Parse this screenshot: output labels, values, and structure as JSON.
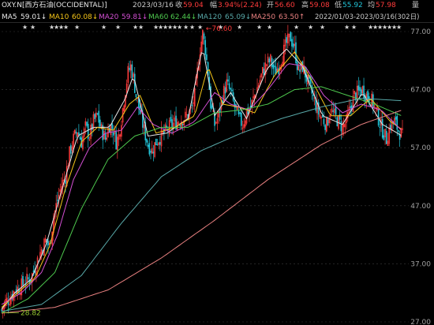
{
  "header": {
    "symbol": "OXY.N[西方石油(OCCIDENTAL)]",
    "date": "2023/03/16",
    "close_label": "收",
    "close_value": "59.04",
    "change_label": "幅",
    "change_value": "3.94%(2.24)",
    "open_label": "开",
    "open_value": "56.60",
    "high_label": "高",
    "high_value": "59.08",
    "low_label": "低",
    "low_value": "55.92",
    "avg_label": "均",
    "avg_value": "57.98",
    "volume_label": "量"
  },
  "ma_row": {
    "ma5_label": "MA5",
    "ma5_value": "59.01↓",
    "ma10_label": "MA10",
    "ma10_value": "60.08↓",
    "ma20_label": "MA20",
    "ma20_value": "59.81↓",
    "ma60_label": "MA60",
    "ma60_value": "62.44↓",
    "ma120_label": "MA120",
    "ma120_value": "65.09↓",
    "ma250_label": "MA250",
    "ma250_value": "63.50↑",
    "range_label": "2022/01/03-2023/03/16(302日)"
  },
  "colors": {
    "background": "#000000",
    "up": "#ff3b3b",
    "down": "#22c4d8",
    "ma5": "#e8e8e8",
    "ma10": "#f5c518",
    "ma20": "#d34fd3",
    "ma60": "#4ec94e",
    "ma120": "#58a8a8",
    "ma250": "#e88080",
    "grid": "#3a3a3a",
    "header_date": "#c8c8c8"
  },
  "chart_data": {
    "type": "candlestick",
    "x_start": "2022/01/03",
    "x_end": "2023/03/16",
    "n_bars": 302,
    "y_ticks": [
      27.0,
      37.0,
      47.0,
      57.0,
      67.0,
      77.0
    ],
    "ylim": [
      27,
      77
    ],
    "annotations": [
      {
        "text": "←76.60",
        "value": 76.6,
        "kind": "max"
      },
      {
        "text": "28.82",
        "value": 28.82,
        "kind": "min"
      }
    ],
    "series": [
      {
        "name": "price",
        "points": [
          [
            0,
            29.0
          ],
          [
            3,
            30.5
          ],
          [
            6,
            31.0
          ],
          [
            10,
            32.5
          ],
          [
            14,
            33.0
          ],
          [
            18,
            34.0
          ],
          [
            22,
            34.5
          ],
          [
            26,
            37.0
          ],
          [
            30,
            39.5
          ],
          [
            33,
            41.0
          ],
          [
            36,
            40.0
          ],
          [
            39,
            45.0
          ],
          [
            42,
            48.0
          ],
          [
            45,
            50.5
          ],
          [
            48,
            52.0
          ],
          [
            51,
            56.0
          ],
          [
            54,
            58.5
          ],
          [
            57,
            60.0
          ],
          [
            60,
            58.0
          ],
          [
            63,
            60.5
          ],
          [
            66,
            59.0
          ],
          [
            69,
            61.5
          ],
          [
            72,
            62.5
          ],
          [
            75,
            60.0
          ],
          [
            78,
            58.5
          ],
          [
            81,
            61.0
          ],
          [
            84,
            60.0
          ],
          [
            86,
            58.0
          ],
          [
            88,
            59.0
          ],
          [
            90,
            62.0
          ],
          [
            93,
            67.0
          ],
          [
            95,
            70.0
          ],
          [
            97,
            71.0
          ],
          [
            99,
            69.0
          ],
          [
            101,
            66.0
          ],
          [
            104,
            63.0
          ],
          [
            107,
            60.0
          ],
          [
            110,
            57.5
          ],
          [
            113,
            56.5
          ],
          [
            116,
            58.0
          ],
          [
            120,
            59.0
          ],
          [
            124,
            60.0
          ],
          [
            128,
            61.0
          ],
          [
            132,
            61.5
          ],
          [
            136,
            62.0
          ],
          [
            140,
            62.5
          ],
          [
            143,
            64.0
          ],
          [
            145,
            66.0
          ],
          [
            147,
            70.0
          ],
          [
            149,
            74.0
          ],
          [
            151,
            76.6
          ],
          [
            153,
            74.0
          ],
          [
            155,
            70.0
          ],
          [
            157,
            64.5
          ],
          [
            160,
            61.0
          ],
          [
            163,
            62.5
          ],
          [
            166,
            66.0
          ],
          [
            169,
            68.0
          ],
          [
            172,
            66.5
          ],
          [
            175,
            64.0
          ],
          [
            178,
            62.0
          ],
          [
            181,
            61.0
          ],
          [
            184,
            63.0
          ],
          [
            187,
            64.0
          ],
          [
            190,
            66.0
          ],
          [
            193,
            68.0
          ],
          [
            196,
            70.0
          ],
          [
            199,
            71.5
          ],
          [
            202,
            72.0
          ],
          [
            205,
            70.0
          ],
          [
            208,
            71.0
          ],
          [
            211,
            73.0
          ],
          [
            214,
            75.0
          ],
          [
            217,
            76.0
          ],
          [
            220,
            74.0
          ],
          [
            223,
            70.0
          ],
          [
            226,
            71.0
          ],
          [
            229,
            69.0
          ],
          [
            232,
            67.0
          ],
          [
            235,
            65.0
          ],
          [
            238,
            63.0
          ],
          [
            241,
            62.0
          ],
          [
            244,
            61.0
          ],
          [
            247,
            63.5
          ],
          [
            250,
            62.5
          ],
          [
            253,
            61.5
          ],
          [
            256,
            60.5
          ],
          [
            259,
            61.5
          ],
          [
            262,
            64.0
          ],
          [
            265,
            66.0
          ],
          [
            268,
            66.5
          ],
          [
            271,
            67.0
          ],
          [
            274,
            66.0
          ],
          [
            277,
            65.5
          ],
          [
            280,
            64.0
          ],
          [
            283,
            62.0
          ],
          [
            286,
            60.0
          ],
          [
            289,
            58.5
          ],
          [
            292,
            61.0
          ],
          [
            295,
            61.5
          ],
          [
            298,
            60.0
          ],
          [
            301,
            59.04
          ]
        ]
      },
      {
        "name": "MA5",
        "points": [
          [
            0,
            29.2
          ],
          [
            10,
            32.0
          ],
          [
            22,
            34.3
          ],
          [
            33,
            40.0
          ],
          [
            45,
            49.5
          ],
          [
            57,
            59.0
          ],
          [
            69,
            60.5
          ],
          [
            81,
            60.5
          ],
          [
            93,
            65.5
          ],
          [
            99,
            69.5
          ],
          [
            110,
            59.0
          ],
          [
            124,
            59.5
          ],
          [
            140,
            62.0
          ],
          [
            151,
            74.5
          ],
          [
            160,
            62.5
          ],
          [
            172,
            66.5
          ],
          [
            184,
            62.0
          ],
          [
            199,
            70.5
          ],
          [
            214,
            74.0
          ],
          [
            226,
            71.0
          ],
          [
            241,
            62.5
          ],
          [
            256,
            61.0
          ],
          [
            271,
            66.5
          ],
          [
            286,
            61.0
          ],
          [
            301,
            59.0
          ]
        ]
      },
      {
        "name": "MA10",
        "points": [
          [
            0,
            29.5
          ],
          [
            12,
            32.0
          ],
          [
            25,
            34.5
          ],
          [
            36,
            40.0
          ],
          [
            48,
            50.0
          ],
          [
            60,
            58.0
          ],
          [
            72,
            60.5
          ],
          [
            84,
            60.0
          ],
          [
            96,
            64.5
          ],
          [
            104,
            66.0
          ],
          [
            116,
            59.5
          ],
          [
            130,
            60.5
          ],
          [
            145,
            62.5
          ],
          [
            155,
            71.0
          ],
          [
            166,
            64.5
          ],
          [
            178,
            64.0
          ],
          [
            190,
            63.0
          ],
          [
            205,
            69.5
          ],
          [
            220,
            73.5
          ],
          [
            232,
            69.0
          ],
          [
            247,
            62.5
          ],
          [
            262,
            62.5
          ],
          [
            277,
            65.5
          ],
          [
            292,
            61.5
          ],
          [
            301,
            60.08
          ]
        ]
      },
      {
        "name": "MA20",
        "points": [
          [
            0,
            30.0
          ],
          [
            15,
            32.0
          ],
          [
            30,
            35.5
          ],
          [
            42,
            42.0
          ],
          [
            54,
            51.5
          ],
          [
            66,
            57.0
          ],
          [
            78,
            59.5
          ],
          [
            90,
            60.0
          ],
          [
            102,
            64.0
          ],
          [
            114,
            61.0
          ],
          [
            128,
            59.5
          ],
          [
            145,
            61.5
          ],
          [
            160,
            66.5
          ],
          [
            172,
            64.5
          ],
          [
            186,
            63.5
          ],
          [
            200,
            67.0
          ],
          [
            215,
            71.5
          ],
          [
            228,
            71.0
          ],
          [
            242,
            66.0
          ],
          [
            256,
            63.0
          ],
          [
            270,
            64.5
          ],
          [
            285,
            63.5
          ],
          [
            301,
            59.81
          ]
        ]
      },
      {
        "name": "MA60",
        "points": [
          [
            0,
            28.5
          ],
          [
            20,
            31.0
          ],
          [
            40,
            35.5
          ],
          [
            60,
            46.5
          ],
          [
            80,
            55.0
          ],
          [
            100,
            59.0
          ],
          [
            120,
            60.5
          ],
          [
            140,
            60.5
          ],
          [
            160,
            63.0
          ],
          [
            180,
            63.5
          ],
          [
            200,
            64.5
          ],
          [
            220,
            67.0
          ],
          [
            240,
            67.5
          ],
          [
            260,
            66.0
          ],
          [
            280,
            64.5
          ],
          [
            301,
            62.44
          ]
        ]
      },
      {
        "name": "MA120",
        "points": [
          [
            0,
            28.8
          ],
          [
            30,
            30.0
          ],
          [
            60,
            35.0
          ],
          [
            90,
            44.0
          ],
          [
            120,
            52.0
          ],
          [
            150,
            56.5
          ],
          [
            180,
            59.5
          ],
          [
            210,
            62.0
          ],
          [
            240,
            64.0
          ],
          [
            270,
            65.5
          ],
          [
            301,
            65.09
          ]
        ]
      },
      {
        "name": "MA250",
        "points": [
          [
            0,
            28.5
          ],
          [
            40,
            29.5
          ],
          [
            80,
            32.5
          ],
          [
            120,
            38.0
          ],
          [
            160,
            44.5
          ],
          [
            200,
            51.5
          ],
          [
            240,
            57.5
          ],
          [
            270,
            61.0
          ],
          [
            301,
            63.5
          ]
        ]
      }
    ]
  }
}
